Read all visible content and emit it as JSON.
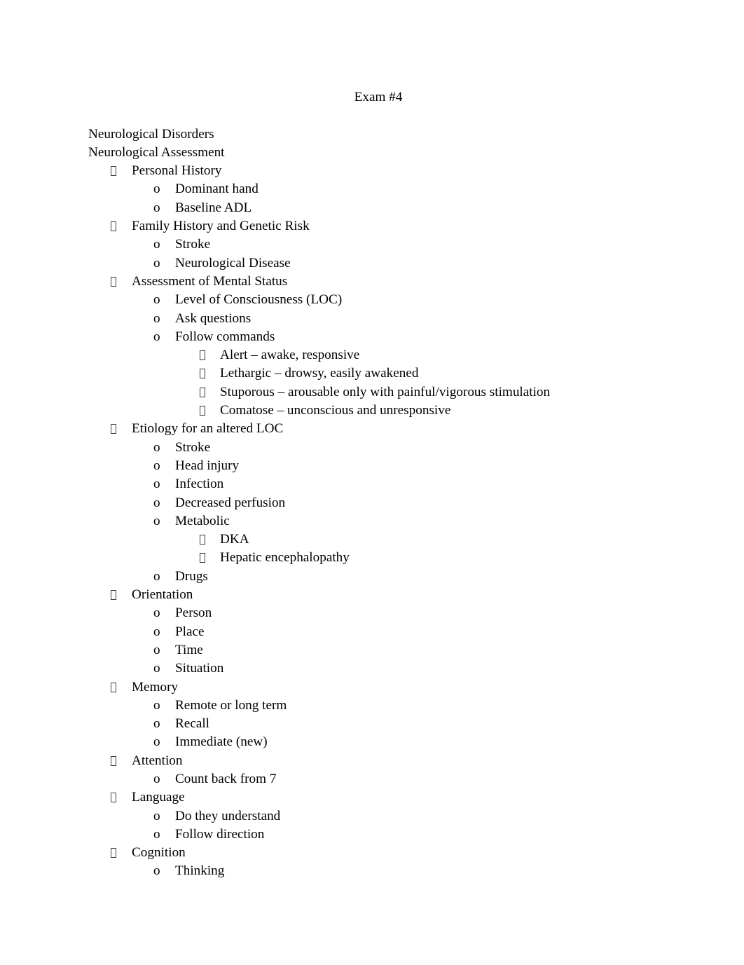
{
  "document": {
    "title": "Exam #4",
    "headings": [
      "Neurological Disorders",
      "Neurological Assessment"
    ],
    "bullet_glyphs": {
      "level1": "missing-glyph-box",
      "level2": "o",
      "level3": "missing-glyph-box"
    },
    "outline": [
      {
        "level": 1,
        "text": "Personal History"
      },
      {
        "level": 2,
        "text": "Dominant hand"
      },
      {
        "level": 2,
        "text": "Baseline ADL"
      },
      {
        "level": 1,
        "text": "Family History and Genetic Risk"
      },
      {
        "level": 2,
        "text": "Stroke"
      },
      {
        "level": 2,
        "text": "Neurological Disease"
      },
      {
        "level": 1,
        "text": "Assessment of Mental Status"
      },
      {
        "level": 2,
        "text": "Level of Consciousness (LOC)"
      },
      {
        "level": 2,
        "text": "Ask questions"
      },
      {
        "level": 2,
        "text": "Follow commands"
      },
      {
        "level": 3,
        "text": "Alert – awake, responsive"
      },
      {
        "level": 3,
        "text": "Lethargic – drowsy, easily awakened"
      },
      {
        "level": 3,
        "text": "Stuporous – arousable only with painful/vigorous stimulation"
      },
      {
        "level": 3,
        "text": "Comatose – unconscious and unresponsive"
      },
      {
        "level": 1,
        "text": "Etiology for an altered LOC"
      },
      {
        "level": 2,
        "text": "Stroke"
      },
      {
        "level": 2,
        "text": "Head injury"
      },
      {
        "level": 2,
        "text": "Infection"
      },
      {
        "level": 2,
        "text": "Decreased perfusion"
      },
      {
        "level": 2,
        "text": "Metabolic"
      },
      {
        "level": 3,
        "text": "DKA"
      },
      {
        "level": 3,
        "text": "Hepatic encephalopathy"
      },
      {
        "level": 2,
        "text": "Drugs"
      },
      {
        "level": 1,
        "text": "Orientation"
      },
      {
        "level": 2,
        "text": "Person"
      },
      {
        "level": 2,
        "text": "Place"
      },
      {
        "level": 2,
        "text": "Time"
      },
      {
        "level": 2,
        "text": "Situation"
      },
      {
        "level": 1,
        "text": "Memory"
      },
      {
        "level": 2,
        "text": "Remote or long term"
      },
      {
        "level": 2,
        "text": "Recall"
      },
      {
        "level": 2,
        "text": "Immediate (new)"
      },
      {
        "level": 1,
        "text": "Attention"
      },
      {
        "level": 2,
        "text": "Count back from 7"
      },
      {
        "level": 1,
        "text": "Language"
      },
      {
        "level": 2,
        "text": "Do they understand"
      },
      {
        "level": 2,
        "text": "Follow direction"
      },
      {
        "level": 1,
        "text": "Cognition"
      },
      {
        "level": 2,
        "text": "Thinking"
      }
    ]
  },
  "colors": {
    "page_background": "#ffffff",
    "text": "#000000",
    "bullet_box_border": "#3a3a3a"
  }
}
